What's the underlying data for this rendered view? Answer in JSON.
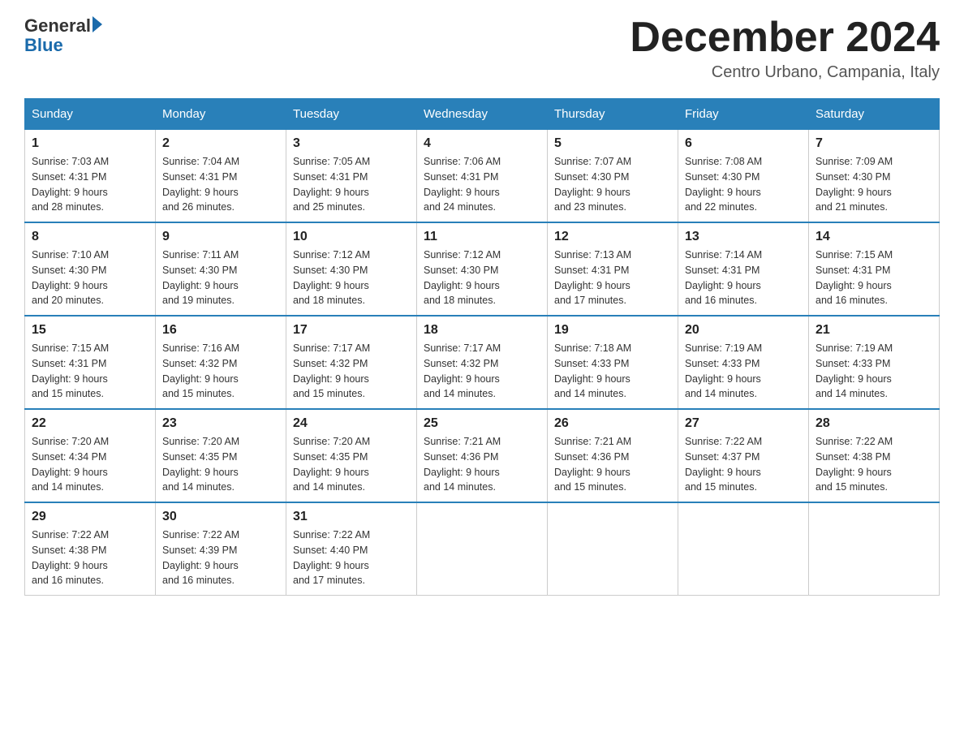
{
  "logo": {
    "text_general": "General",
    "text_blue": "Blue"
  },
  "header": {
    "month_year": "December 2024",
    "location": "Centro Urbano, Campania, Italy"
  },
  "days_of_week": [
    "Sunday",
    "Monday",
    "Tuesday",
    "Wednesday",
    "Thursday",
    "Friday",
    "Saturday"
  ],
  "weeks": [
    [
      {
        "day": "1",
        "sunrise": "7:03 AM",
        "sunset": "4:31 PM",
        "daylight": "9 hours and 28 minutes."
      },
      {
        "day": "2",
        "sunrise": "7:04 AM",
        "sunset": "4:31 PM",
        "daylight": "9 hours and 26 minutes."
      },
      {
        "day": "3",
        "sunrise": "7:05 AM",
        "sunset": "4:31 PM",
        "daylight": "9 hours and 25 minutes."
      },
      {
        "day": "4",
        "sunrise": "7:06 AM",
        "sunset": "4:31 PM",
        "daylight": "9 hours and 24 minutes."
      },
      {
        "day": "5",
        "sunrise": "7:07 AM",
        "sunset": "4:30 PM",
        "daylight": "9 hours and 23 minutes."
      },
      {
        "day": "6",
        "sunrise": "7:08 AM",
        "sunset": "4:30 PM",
        "daylight": "9 hours and 22 minutes."
      },
      {
        "day": "7",
        "sunrise": "7:09 AM",
        "sunset": "4:30 PM",
        "daylight": "9 hours and 21 minutes."
      }
    ],
    [
      {
        "day": "8",
        "sunrise": "7:10 AM",
        "sunset": "4:30 PM",
        "daylight": "9 hours and 20 minutes."
      },
      {
        "day": "9",
        "sunrise": "7:11 AM",
        "sunset": "4:30 PM",
        "daylight": "9 hours and 19 minutes."
      },
      {
        "day": "10",
        "sunrise": "7:12 AM",
        "sunset": "4:30 PM",
        "daylight": "9 hours and 18 minutes."
      },
      {
        "day": "11",
        "sunrise": "7:12 AM",
        "sunset": "4:30 PM",
        "daylight": "9 hours and 18 minutes."
      },
      {
        "day": "12",
        "sunrise": "7:13 AM",
        "sunset": "4:31 PM",
        "daylight": "9 hours and 17 minutes."
      },
      {
        "day": "13",
        "sunrise": "7:14 AM",
        "sunset": "4:31 PM",
        "daylight": "9 hours and 16 minutes."
      },
      {
        "day": "14",
        "sunrise": "7:15 AM",
        "sunset": "4:31 PM",
        "daylight": "9 hours and 16 minutes."
      }
    ],
    [
      {
        "day": "15",
        "sunrise": "7:15 AM",
        "sunset": "4:31 PM",
        "daylight": "9 hours and 15 minutes."
      },
      {
        "day": "16",
        "sunrise": "7:16 AM",
        "sunset": "4:32 PM",
        "daylight": "9 hours and 15 minutes."
      },
      {
        "day": "17",
        "sunrise": "7:17 AM",
        "sunset": "4:32 PM",
        "daylight": "9 hours and 15 minutes."
      },
      {
        "day": "18",
        "sunrise": "7:17 AM",
        "sunset": "4:32 PM",
        "daylight": "9 hours and 14 minutes."
      },
      {
        "day": "19",
        "sunrise": "7:18 AM",
        "sunset": "4:33 PM",
        "daylight": "9 hours and 14 minutes."
      },
      {
        "day": "20",
        "sunrise": "7:19 AM",
        "sunset": "4:33 PM",
        "daylight": "9 hours and 14 minutes."
      },
      {
        "day": "21",
        "sunrise": "7:19 AM",
        "sunset": "4:33 PM",
        "daylight": "9 hours and 14 minutes."
      }
    ],
    [
      {
        "day": "22",
        "sunrise": "7:20 AM",
        "sunset": "4:34 PM",
        "daylight": "9 hours and 14 minutes."
      },
      {
        "day": "23",
        "sunrise": "7:20 AM",
        "sunset": "4:35 PM",
        "daylight": "9 hours and 14 minutes."
      },
      {
        "day": "24",
        "sunrise": "7:20 AM",
        "sunset": "4:35 PM",
        "daylight": "9 hours and 14 minutes."
      },
      {
        "day": "25",
        "sunrise": "7:21 AM",
        "sunset": "4:36 PM",
        "daylight": "9 hours and 14 minutes."
      },
      {
        "day": "26",
        "sunrise": "7:21 AM",
        "sunset": "4:36 PM",
        "daylight": "9 hours and 15 minutes."
      },
      {
        "day": "27",
        "sunrise": "7:22 AM",
        "sunset": "4:37 PM",
        "daylight": "9 hours and 15 minutes."
      },
      {
        "day": "28",
        "sunrise": "7:22 AM",
        "sunset": "4:38 PM",
        "daylight": "9 hours and 15 minutes."
      }
    ],
    [
      {
        "day": "29",
        "sunrise": "7:22 AM",
        "sunset": "4:38 PM",
        "daylight": "9 hours and 16 minutes."
      },
      {
        "day": "30",
        "sunrise": "7:22 AM",
        "sunset": "4:39 PM",
        "daylight": "9 hours and 16 minutes."
      },
      {
        "day": "31",
        "sunrise": "7:22 AM",
        "sunset": "4:40 PM",
        "daylight": "9 hours and 17 minutes."
      },
      null,
      null,
      null,
      null
    ]
  ],
  "labels": {
    "sunrise": "Sunrise:",
    "sunset": "Sunset:",
    "daylight": "Daylight:"
  }
}
